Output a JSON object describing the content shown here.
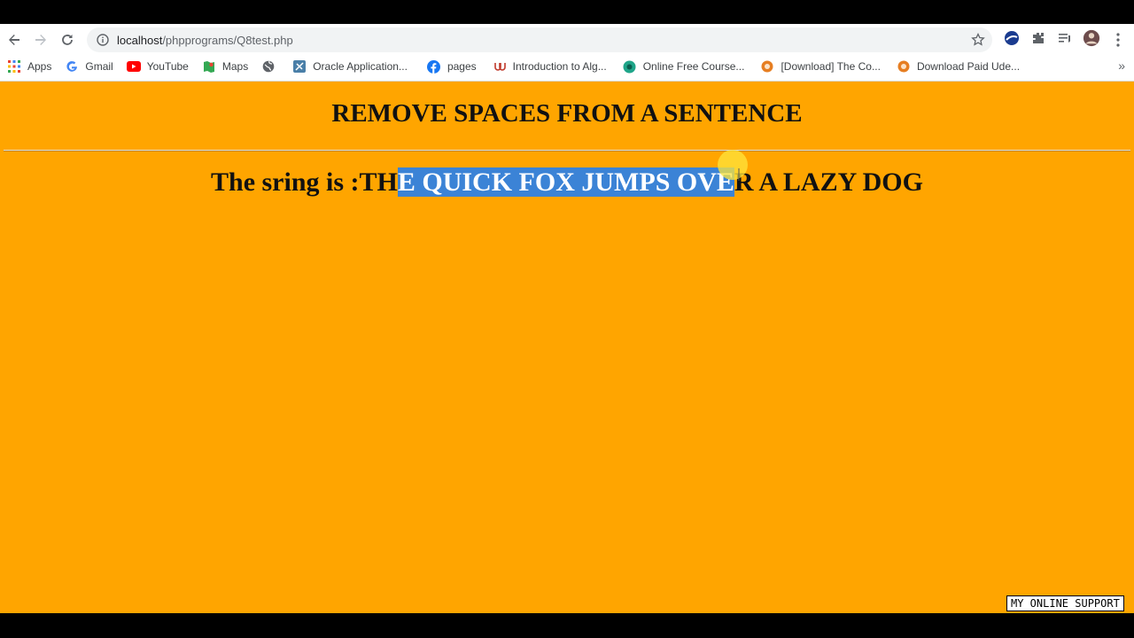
{
  "browser": {
    "url_host": "localhost",
    "url_path": "/phpprograms/Q8test.php",
    "bookmarks": [
      {
        "label": "Apps",
        "icon": "apps-grid-icon"
      },
      {
        "label": "Gmail",
        "icon": "google-g-icon"
      },
      {
        "label": "YouTube",
        "icon": "youtube-icon"
      },
      {
        "label": "Maps",
        "icon": "maps-icon"
      },
      {
        "label": "",
        "icon": "globe-icon"
      },
      {
        "label": "Oracle Application...",
        "icon": "oracle-icon"
      },
      {
        "label": "pages",
        "icon": "facebook-icon"
      },
      {
        "label": "Introduction to Alg...",
        "icon": "udemy-icon"
      },
      {
        "label": "Online Free Course...",
        "icon": "course-icon"
      },
      {
        "label": "[Download] The Co...",
        "icon": "download-site-icon"
      },
      {
        "label": "Download Paid Ude...",
        "icon": "download-site-icon"
      }
    ],
    "more_label": "»"
  },
  "page": {
    "heading": "REMOVE SPACES FROM A SENTENCE",
    "sentence_prefix": "The sring is :TH",
    "sentence_selected": "E QUICK FOX JUMPS OVE",
    "sentence_suffix": "R A LAZY DOG",
    "background_color": "#FFA500",
    "selection_color": "#3b83d6"
  },
  "watermark": "MY ONLINE SUPPORT"
}
